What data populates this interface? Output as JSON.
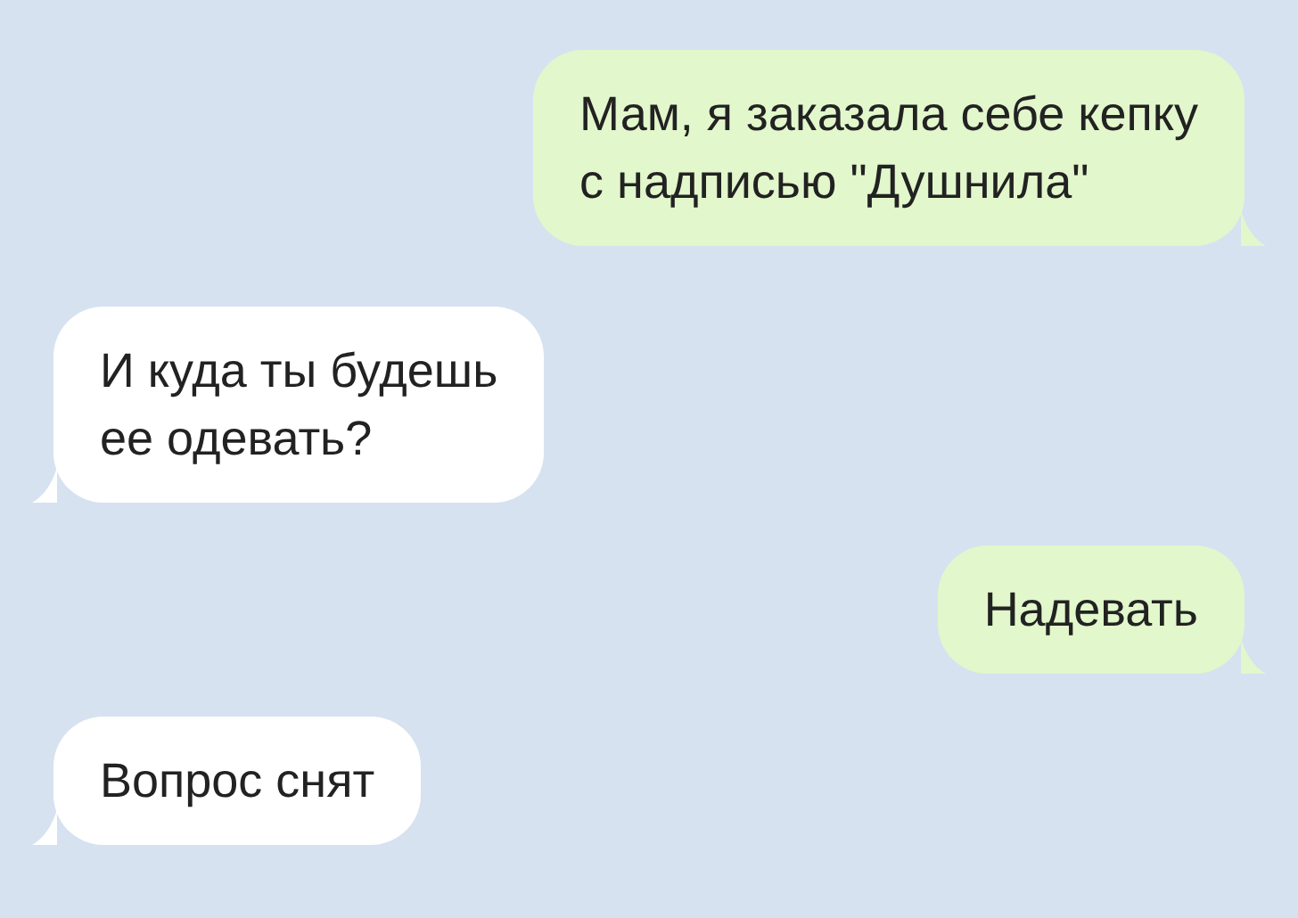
{
  "messages": [
    {
      "kind": "outgoing",
      "text": "Мам, я заказала себе кепку\nс надписью \"Душнила\""
    },
    {
      "kind": "incoming",
      "text": "И куда ты будешь\nее одевать?"
    },
    {
      "kind": "outgoing",
      "text": "Надевать"
    },
    {
      "kind": "incoming",
      "text": "Вопрос снят"
    }
  ]
}
